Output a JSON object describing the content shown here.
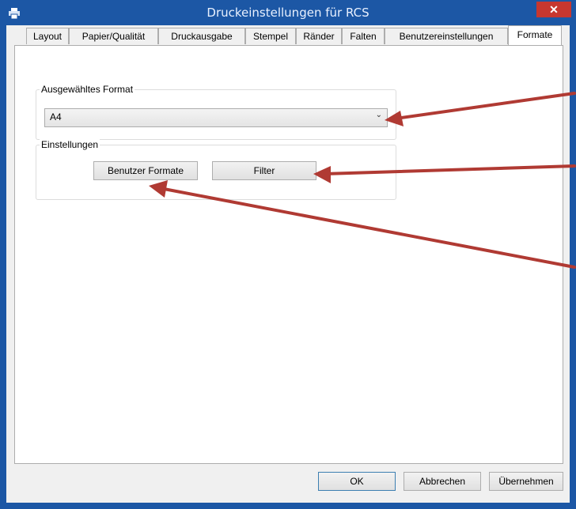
{
  "window": {
    "title": "Druckeinstellungen für RCS",
    "close_label": "✕"
  },
  "tabs": [
    {
      "label": "Layout"
    },
    {
      "label": "Papier/Qualität"
    },
    {
      "label": "Druckausgabe"
    },
    {
      "label": "Stempel"
    },
    {
      "label": "Ränder"
    },
    {
      "label": "Falten"
    },
    {
      "label": "Benutzereinstellungen"
    },
    {
      "label": "Formate",
      "active": true
    }
  ],
  "format_group": {
    "label": "Ausgewähltes Format",
    "selected_value": "A4"
  },
  "settings_group": {
    "label": "Einstellungen",
    "custom_formats_label": "Benutzer Formate",
    "filter_label": "Filter"
  },
  "footer": {
    "ok_label": "OK",
    "cancel_label": "Abbrechen",
    "apply_label": "Übernehmen"
  },
  "colors": {
    "titlebar": "#1c57a5",
    "close": "#c7372f",
    "annotation_arrow": "#b03a33"
  }
}
